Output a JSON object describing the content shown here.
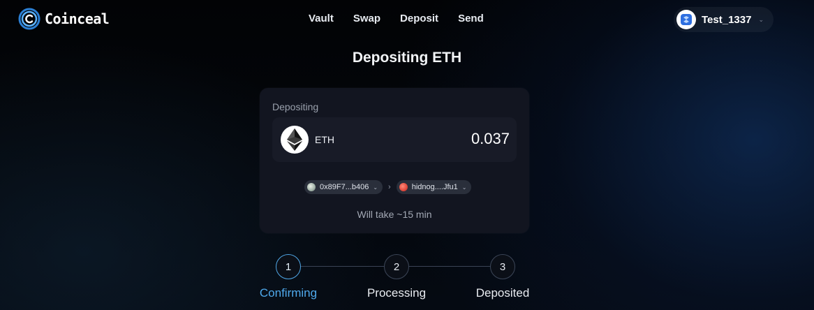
{
  "header": {
    "brand": "Coinceal",
    "nav": [
      "Vault",
      "Swap",
      "Deposit",
      "Send"
    ],
    "user": {
      "name": "Test_1337",
      "avatar_icon": "blue-glyph-avatar-icon"
    }
  },
  "page": {
    "title": "Depositing ETH"
  },
  "deposit_card": {
    "label": "Depositing",
    "asset": {
      "symbol": "ETH",
      "amount": "0.037",
      "icon": "ethereum-icon"
    },
    "route": {
      "from": "0x89F7...b406",
      "to": "hidnog....Jfu1"
    },
    "eta": "Will take ~15 min"
  },
  "steps": [
    {
      "number": "1",
      "label": "Confirming",
      "active": true
    },
    {
      "number": "2",
      "label": "Processing",
      "active": false
    },
    {
      "number": "3",
      "label": "Deposited",
      "active": false
    }
  ],
  "colors": {
    "accent": "#4fa9ec",
    "card_bg": "#121520",
    "background": "#020305"
  }
}
